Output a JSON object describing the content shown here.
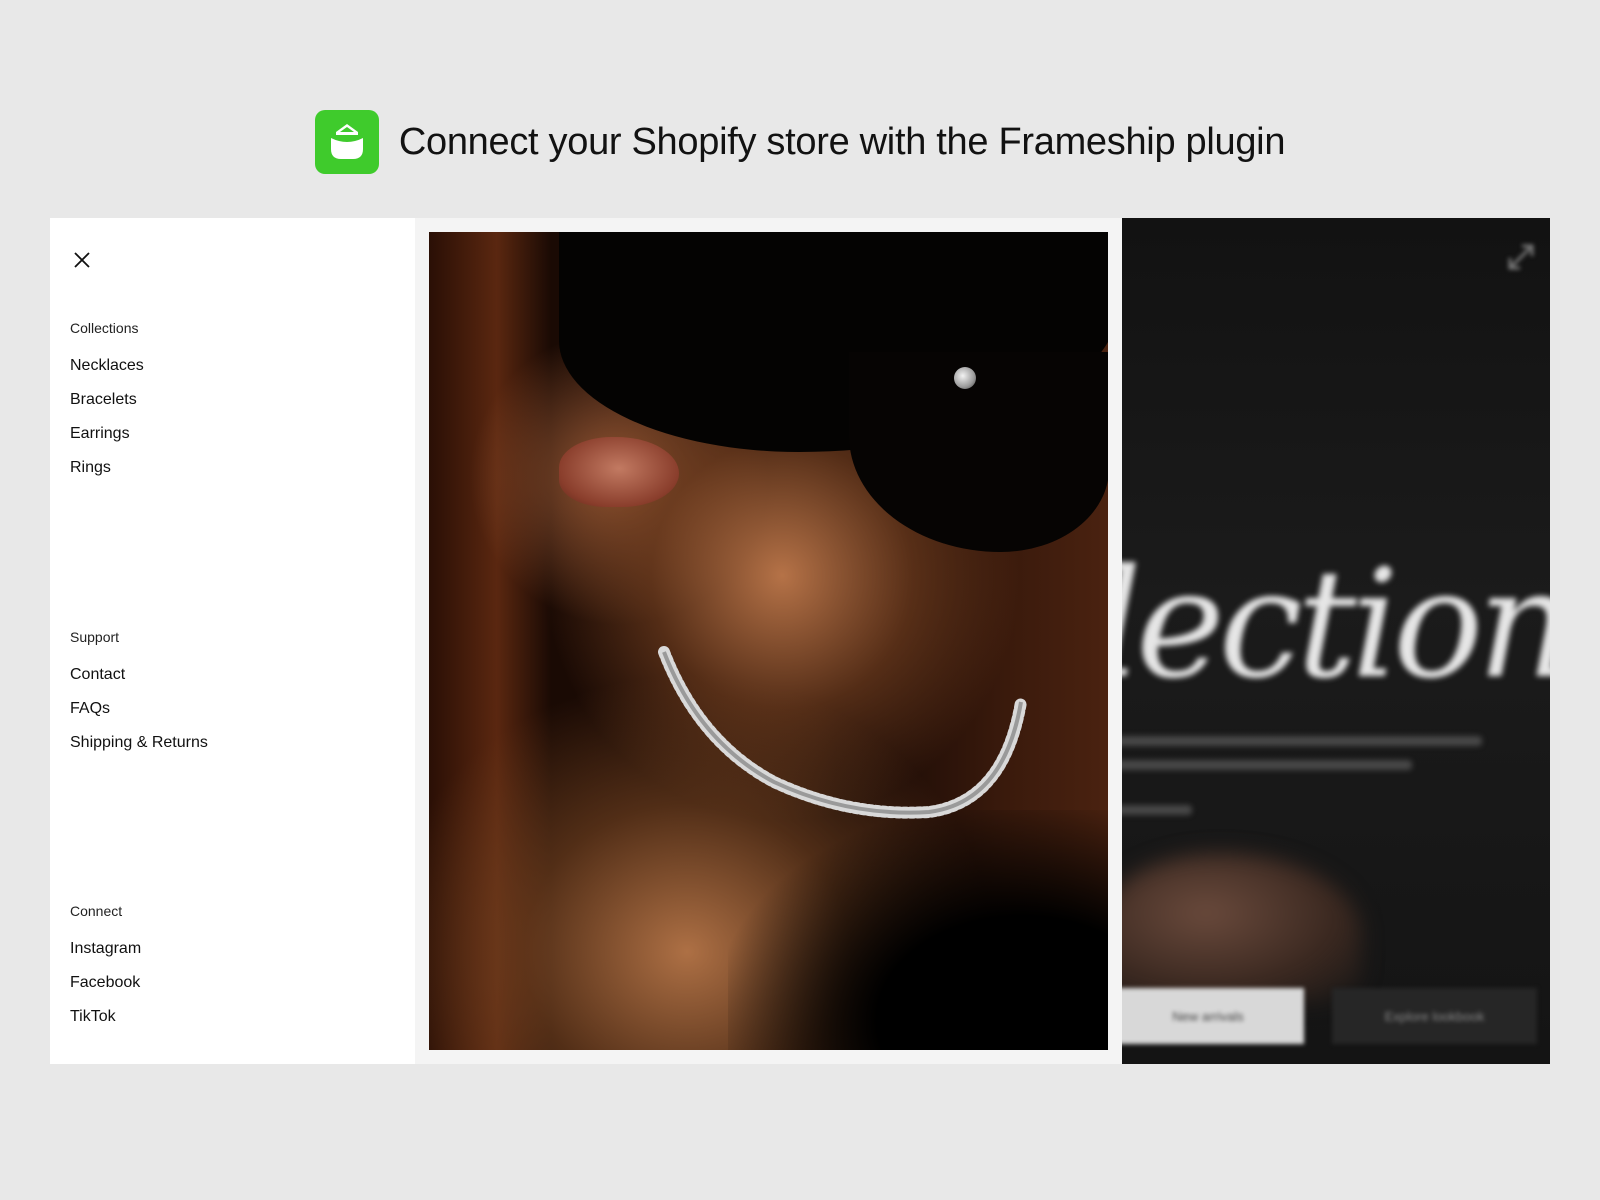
{
  "header": {
    "title": "Connect your Shopify store with the Frameship plugin",
    "logo_icon": "shopify-bag-icon",
    "logo_color": "#3fcb2c"
  },
  "menu": {
    "close_icon": "close-icon",
    "sections": [
      {
        "label": "Collections",
        "links": [
          "Necklaces",
          "Bracelets",
          "Earrings",
          "Rings"
        ]
      },
      {
        "label": "Support",
        "links": [
          "Contact",
          "FAQs",
          "Shipping & Returns"
        ]
      },
      {
        "label": "Connect",
        "links": [
          "Instagram",
          "Facebook",
          "TikTok"
        ]
      }
    ]
  },
  "preview": {
    "title": "llection",
    "primary_button": "New arrivals",
    "secondary_button": "Explore lookbook"
  },
  "colors": {
    "background": "#e8e8e8",
    "menu_background": "#ffffff",
    "preview_background": "#141414"
  }
}
